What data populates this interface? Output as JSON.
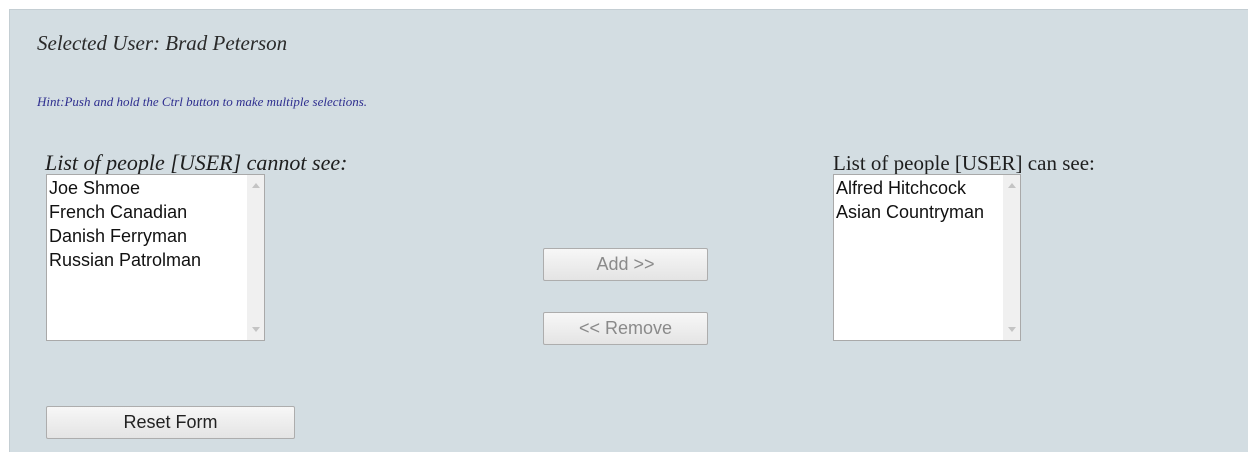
{
  "header": {
    "selected_user": "Selected User: Brad Peterson",
    "hint": "Hint:Push and hold the Ctrl button to make multiple selections."
  },
  "left_list": {
    "label": "List of people [USER] cannot see:",
    "items": [
      "Joe Shmoe",
      "French Canadian",
      "Danish Ferryman",
      "Russian Patrolman"
    ]
  },
  "right_list": {
    "label": "List of people [USER] can see:",
    "items": [
      "Alfred Hitchcock",
      "Asian Countryman"
    ]
  },
  "buttons": {
    "add_label": "Add >>",
    "remove_label": "<< Remove",
    "reset_label": "Reset Form"
  },
  "colors": {
    "panel_background": "#d3dde2",
    "hint_text": "#2e2e8f"
  }
}
